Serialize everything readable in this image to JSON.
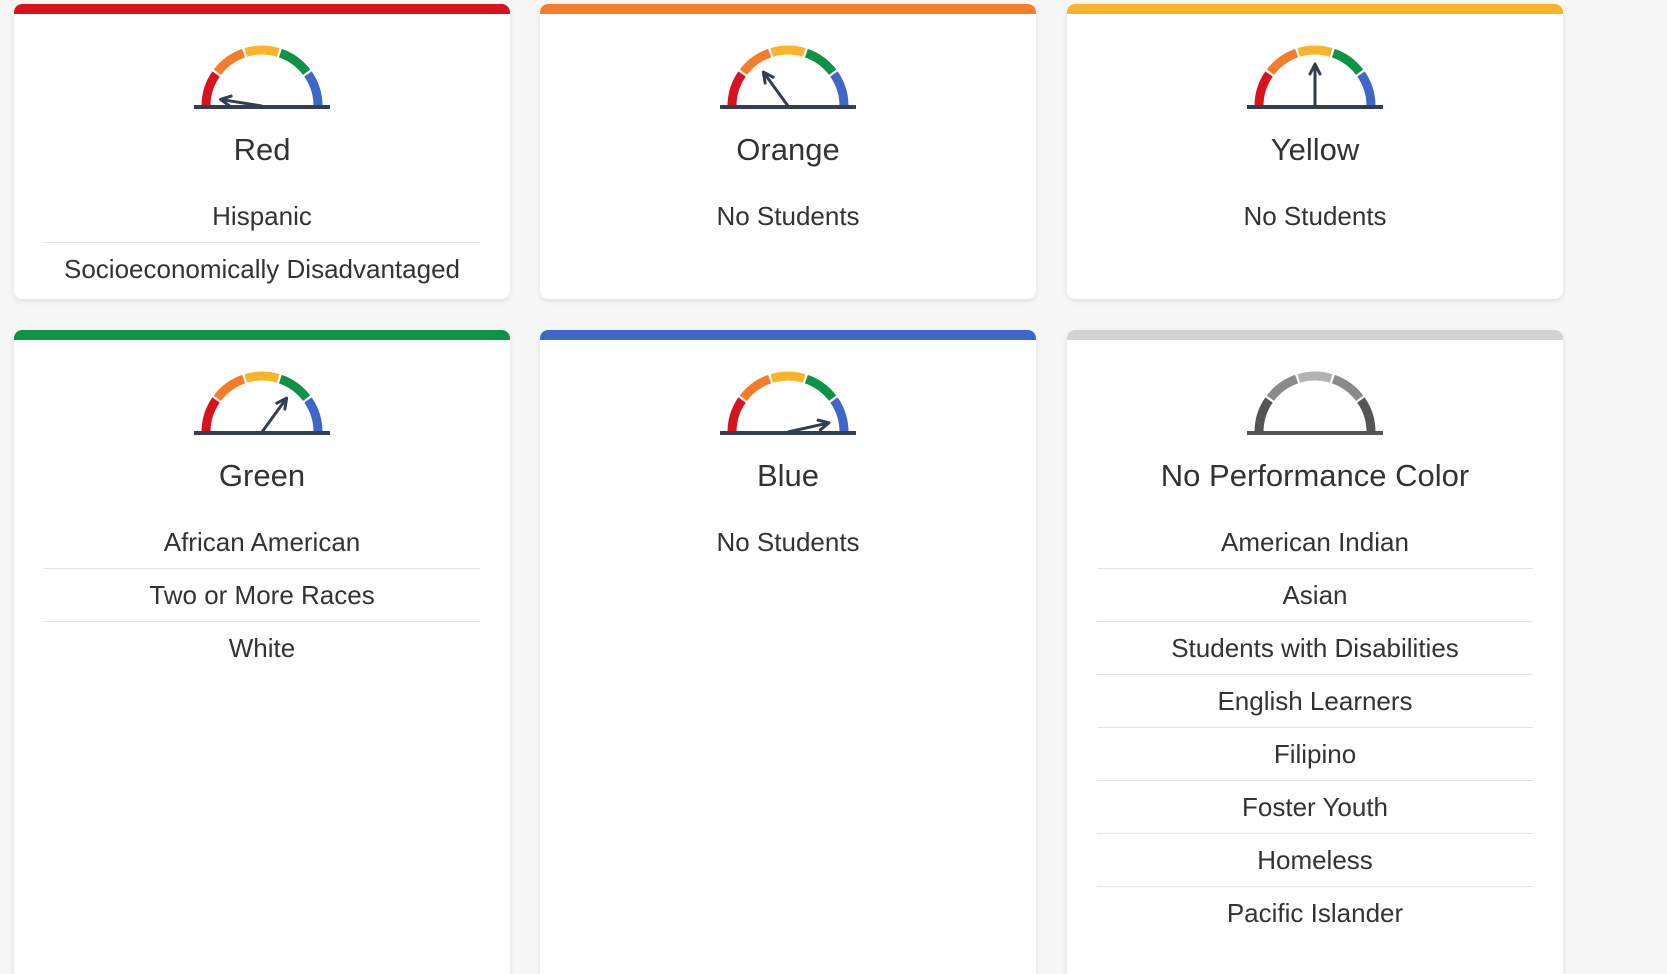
{
  "colors": {
    "red": "#d7141e",
    "orange": "#f57d2a",
    "yellow": "#fab32c",
    "green": "#0e9245",
    "blue": "#3f67c8",
    "gray": "#d3d3d3",
    "needle": "#333f4f"
  },
  "cards": [
    {
      "title": "Red",
      "color_key": "red",
      "gauge_icon": "gauge-red-icon",
      "gauge_level": 0.05,
      "groups": [
        "Hispanic",
        "Socioeconomically Disadvantaged"
      ]
    },
    {
      "title": "Orange",
      "color_key": "orange",
      "gauge_icon": "gauge-orange-icon",
      "gauge_level": 0.3,
      "empty_text": "No Students",
      "groups": []
    },
    {
      "title": "Yellow",
      "color_key": "yellow",
      "gauge_icon": "gauge-yellow-icon",
      "gauge_level": 0.5,
      "empty_text": "No Students",
      "groups": []
    },
    {
      "title": "Green",
      "color_key": "green",
      "gauge_icon": "gauge-green-icon",
      "gauge_level": 0.7,
      "groups": [
        "African American",
        "Two or More Races",
        "White"
      ]
    },
    {
      "title": "Blue",
      "color_key": "blue",
      "gauge_icon": "gauge-blue-icon",
      "gauge_level": 0.93,
      "empty_text": "No Students",
      "groups": []
    },
    {
      "title": "No Performance Color",
      "color_key": "gray",
      "gauge_icon": "gauge-no-color-icon",
      "gauge_level": null,
      "groups": [
        "American Indian",
        "Asian",
        "Students with Disabilities",
        "English Learners",
        "Filipino",
        "Foster Youth",
        "Homeless",
        "Pacific Islander"
      ]
    }
  ]
}
